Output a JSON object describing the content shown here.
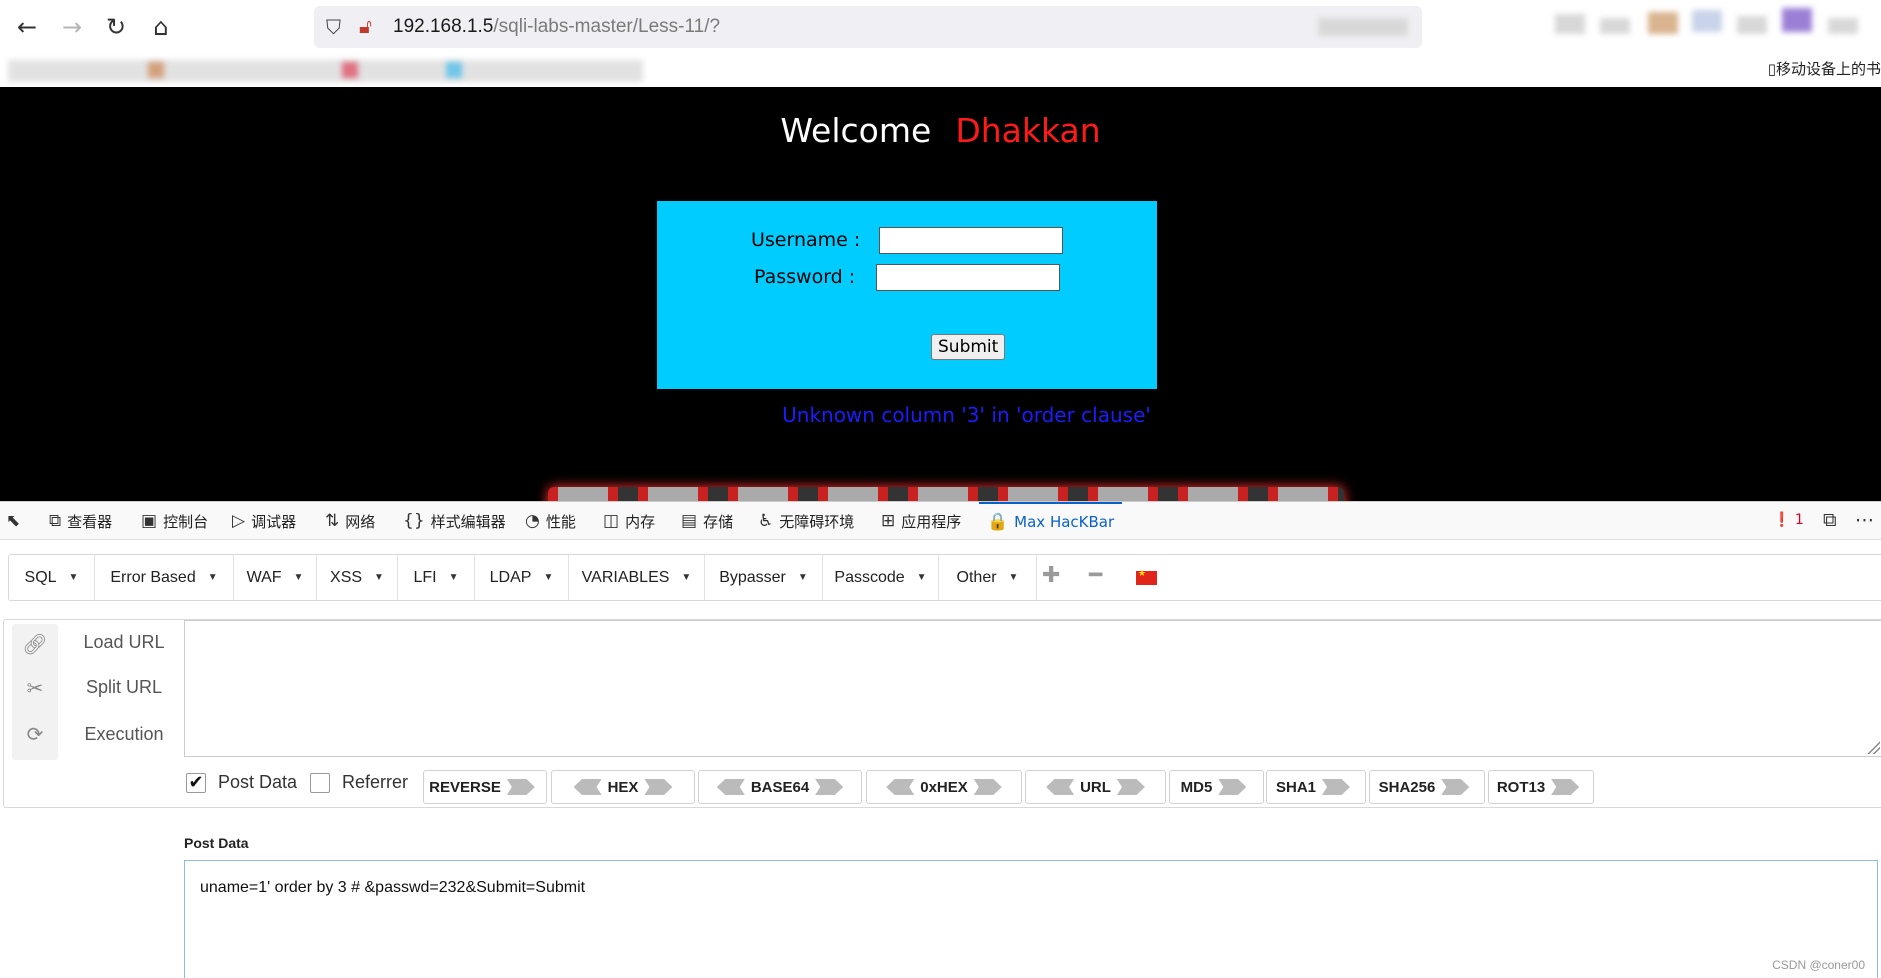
{
  "browser": {
    "url_host": "192.168.1.5",
    "url_path": "/sqli-labs-master/Less-11/?",
    "mobile_bookmarks": "移动设备上的书"
  },
  "page": {
    "welcome": "Welcome",
    "name": "Dhakkan",
    "username_label": "Username :",
    "password_label": "Password :",
    "submit_label": "Submit",
    "error_message": "Unknown column '3' in 'order clause'"
  },
  "devtools": {
    "tabs": [
      {
        "icon": "inspector-icon",
        "glyph": "⧉",
        "label": "查看器"
      },
      {
        "icon": "console-icon",
        "glyph": "▣",
        "label": "控制台"
      },
      {
        "icon": "debugger-icon",
        "glyph": "▷",
        "label": "调试器"
      },
      {
        "icon": "network-icon",
        "glyph": "⇅",
        "label": "网络"
      },
      {
        "icon": "style-editor-icon",
        "glyph": "{}",
        "label": "样式编辑器"
      },
      {
        "icon": "performance-icon",
        "glyph": "◔",
        "label": "性能"
      },
      {
        "icon": "memory-icon",
        "glyph": "◫",
        "label": "内存"
      },
      {
        "icon": "storage-icon",
        "glyph": "▤",
        "label": "存储"
      },
      {
        "icon": "accessibility-icon",
        "glyph": "♿",
        "label": "无障碍环境"
      },
      {
        "icon": "application-icon",
        "glyph": "⊞",
        "label": "应用程序"
      },
      {
        "icon": "hackbar-icon",
        "glyph": "🔒",
        "label": "Max HacKBar"
      }
    ],
    "error_count": "1"
  },
  "hackbar": {
    "menus": [
      "SQL",
      "Error Based",
      "WAF",
      "XSS",
      "LFI",
      "LDAP",
      "VARIABLES",
      "Bypasser",
      "Passcode",
      "Other"
    ],
    "actions": [
      "Load URL",
      "Split URL",
      "Execution"
    ],
    "post_data_checkbox": "Post Data",
    "post_data_checked": true,
    "referrer_checkbox": "Referrer",
    "referrer_checked": false,
    "encoders": [
      "REVERSE",
      "HEX",
      "BASE64",
      "0xHEX",
      "URL",
      "MD5",
      "SHA1",
      "SHA256",
      "ROT13"
    ],
    "post_data_label": "Post Data",
    "post_data_value": "uname=1' order by 3 # &passwd=232&Submit=Submit"
  },
  "watermark": "CSDN @coner00"
}
